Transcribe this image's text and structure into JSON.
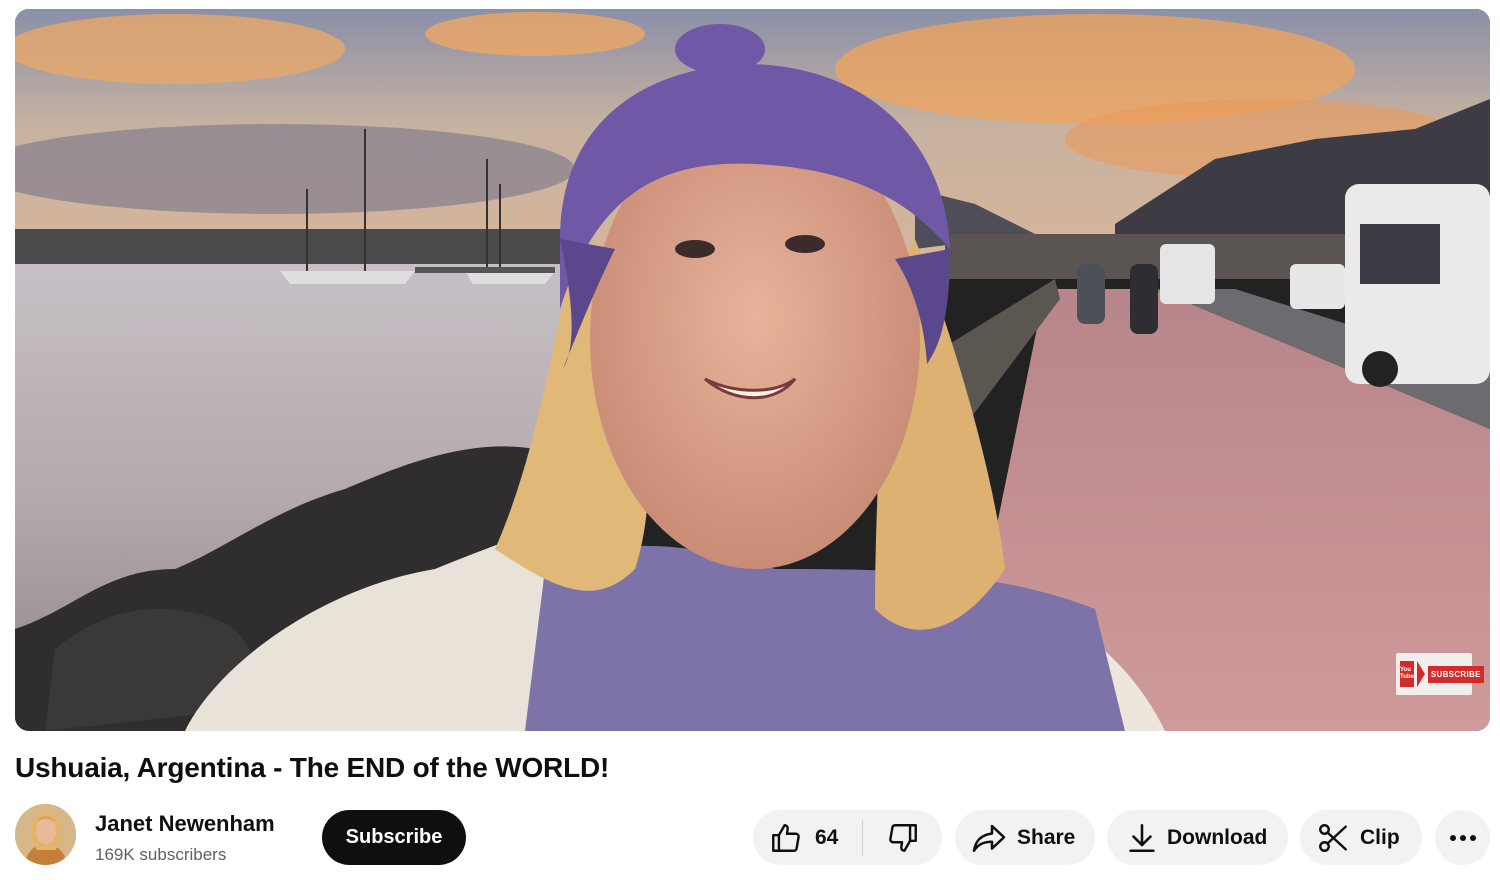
{
  "video": {
    "title": "Ushuaia, Argentina - The END of the WORLD!",
    "watermark": {
      "logo_text": "You Tube",
      "label": "SUBSCRIBE"
    }
  },
  "channel": {
    "name": "Janet Newenham",
    "subscribers": "169K subscribers"
  },
  "actions": {
    "subscribe_label": "Subscribe",
    "like_count": "64",
    "share_label": "Share",
    "download_label": "Download",
    "clip_label": "Clip"
  },
  "icons": {
    "like": "thumbs-up-icon",
    "dislike": "thumbs-down-icon",
    "share": "share-arrow-icon",
    "download": "download-icon",
    "clip": "scissors-icon",
    "more": "more-horizontal-icon"
  },
  "colors": {
    "subscribe_bg": "#0f0f0f",
    "pill_bg": "#f2f2f2",
    "secondary_text": "#606060"
  }
}
